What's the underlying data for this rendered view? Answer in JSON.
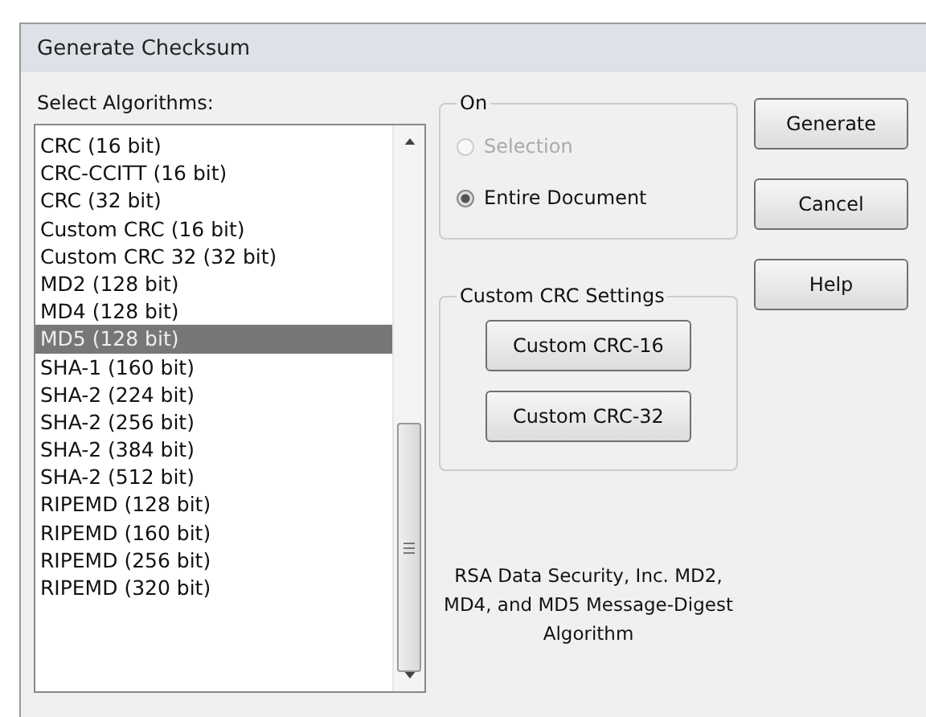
{
  "window": {
    "title": "Generate Checksum"
  },
  "algorithms": {
    "label": "Select Algorithms:",
    "items": [
      {
        "label": "CRC (16 bit)",
        "selected": false
      },
      {
        "label": "CRC-CCITT (16 bit)",
        "selected": false
      },
      {
        "label": "CRC (32 bit)",
        "selected": false
      },
      {
        "label": "Custom CRC (16 bit)",
        "selected": false
      },
      {
        "label": "Custom CRC 32 (32 bit)",
        "selected": false
      },
      {
        "label": "MD2 (128 bit)",
        "selected": false
      },
      {
        "label": "MD4 (128 bit)",
        "selected": false
      },
      {
        "label": "MD5 (128 bit)",
        "selected": true
      },
      {
        "label": "SHA-1 (160 bit)",
        "selected": false
      },
      {
        "label": "SHA-2 (224 bit)",
        "selected": false
      },
      {
        "label": "SHA-2 (256 bit)",
        "selected": false
      },
      {
        "label": "SHA-2 (384 bit)",
        "selected": false
      },
      {
        "label": "SHA-2 (512 bit)",
        "selected": false
      },
      {
        "label": "RIPEMD (128 bit)",
        "selected": false
      },
      {
        "label": "RIPEMD (160 bit)",
        "selected": false
      },
      {
        "label": "RIPEMD (256 bit)",
        "selected": false
      },
      {
        "label": "RIPEMD (320 bit)",
        "selected": false
      }
    ]
  },
  "on": {
    "label": "On",
    "options": [
      {
        "label": "Selection",
        "selected": false,
        "disabled": true
      },
      {
        "label": "Entire Document",
        "selected": true,
        "disabled": false
      }
    ]
  },
  "custom_crc": {
    "label": "Custom CRC Settings",
    "buttons": [
      "Custom CRC-16",
      "Custom CRC-32"
    ]
  },
  "note": "RSA Data Security, Inc. MD2, MD4, and MD5 Message-Digest Algorithm",
  "buttons": [
    "Generate",
    "Cancel",
    "Help"
  ]
}
